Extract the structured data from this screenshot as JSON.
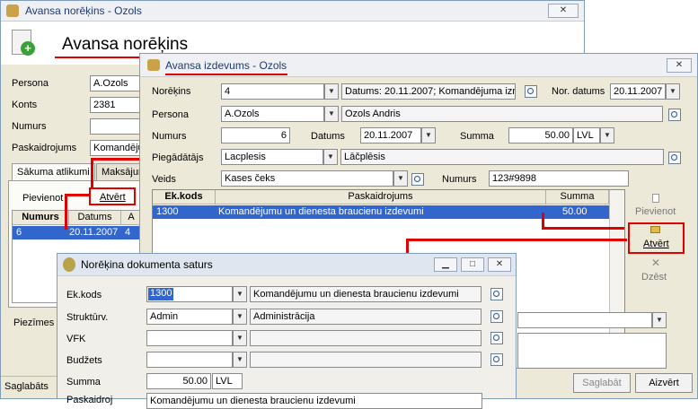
{
  "back_window": {
    "title": "Avansa norēķins - Ozols",
    "heading": "Avansa norēķins",
    "labels": {
      "persona": "Persona",
      "konts": "Konts",
      "numurs": "Numurs",
      "paskaidrojums": "Paskaidrojums",
      "piezimes": "Piezīmes"
    },
    "values": {
      "persona": "A.Ozols",
      "konts": "2381",
      "numurs": "",
      "paskaidrojums": "Komandējum"
    },
    "tabs": [
      "Sākuma atlikumi",
      "Maksājum"
    ],
    "actions": {
      "pievienot": "Pievienot",
      "atvert": "Atvērt"
    },
    "table": {
      "columns": [
        "Numurs",
        "Datums",
        "A"
      ],
      "rows": [
        [
          "6",
          "20.11.2007",
          "4"
        ]
      ]
    },
    "status": "Saglabāts"
  },
  "mid_window": {
    "title": "Avansa izdevums - Ozols",
    "labels": {
      "norekins": "Norēķins",
      "nor_datums": "Nor. datums",
      "persona": "Persona",
      "numurs": "Numurs",
      "datums": "Datums",
      "summa": "Summa",
      "piegadatajs": "Piegādātājs",
      "veids": "Veids",
      "numurs2": "Numurs"
    },
    "values": {
      "norekins": "4",
      "norekins_desc": "Datums: 20.11.2007; Komandējuma izm",
      "nor_datums": "20.11.2007",
      "persona": "A.Ozols",
      "persona_name": "Ozols Andris",
      "numurs": "6",
      "datums": "20.11.2007",
      "summa": "50.00",
      "currency": "LVL",
      "piegadatajs": "Lacplesis",
      "piegadatajs_name": "Lāčplēsis",
      "veids": "Kases čeks",
      "numurs2": "123#9898"
    },
    "table": {
      "columns": [
        "Ek.kods",
        "Paskaidrojums",
        "Summa"
      ],
      "rows": [
        [
          "1300",
          "Komandējumu un dienesta braucienu izdevumi",
          "50.00"
        ]
      ]
    },
    "side_buttons": {
      "pievienot": "Pievienot",
      "atvert": "Atvērt",
      "dzest": "Dzēst"
    },
    "bottom_buttons": {
      "saglabat": "Saglabāt",
      "aizvert": "Aizvērt"
    }
  },
  "front_window": {
    "title": "Norēķina dokumenta saturs",
    "labels": {
      "ek_kods": "Ek.kods",
      "strukturv": "Struktūrv.",
      "vfk": "VFK",
      "budzets": "Budžets",
      "summa": "Summa",
      "paskaidrojums": "Paskaidroj"
    },
    "values": {
      "ek_kods": "1300",
      "ek_kods_name": "Komandējumu un dienesta braucienu izdevumi",
      "strukturv": "Admin",
      "strukturv_name": "Administrācija",
      "vfk": "",
      "budzets": "",
      "summa": "50.00",
      "currency": "LVL",
      "paskaidrojums": "Komandējumu un dienesta braucienu izdevumi"
    }
  },
  "colors": {
    "accent_red": "#e00000",
    "selection": "#3366cc"
  }
}
